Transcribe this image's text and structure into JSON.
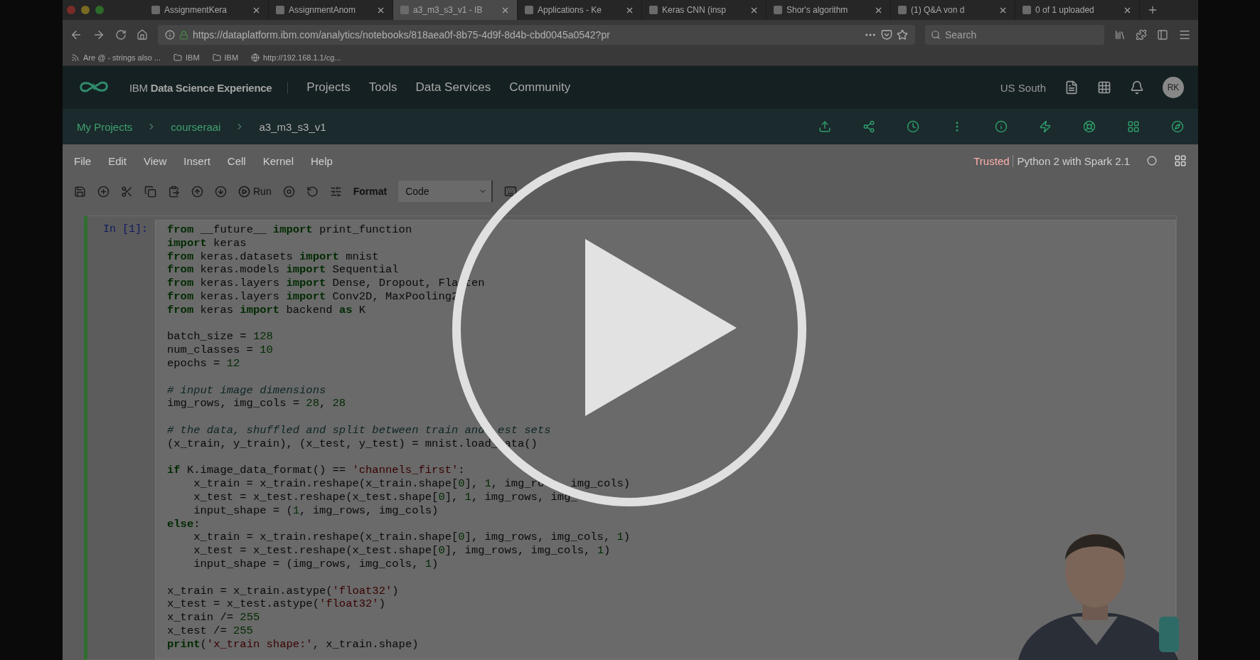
{
  "browser": {
    "tabs": [
      {
        "title": "AssignmentKera",
        "selected": false
      },
      {
        "title": "AssignmentAnom",
        "selected": false
      },
      {
        "title": "a3_m3_s3_v1 - IB",
        "selected": true
      },
      {
        "title": "Applications - Ke",
        "selected": false
      },
      {
        "title": "Keras CNN (insp",
        "selected": false
      },
      {
        "title": "Shor's algorithm",
        "selected": false
      },
      {
        "title": "(1) Q&A von d",
        "selected": false
      },
      {
        "title": "0 of 1 uploaded",
        "selected": false
      }
    ],
    "url": "https://dataplatform.ibm.com/analytics/notebooks/818aea0f-8b75-4d9f-8d4b-cbd0045a0542?pr",
    "search": {
      "placeholder": "Search"
    },
    "bookmarks": [
      {
        "kind": "feed",
        "label": "Are @ - strings also ..."
      },
      {
        "kind": "folder",
        "label": "IBM"
      },
      {
        "kind": "folder",
        "label": "IBM"
      },
      {
        "kind": "globe",
        "label": "http://192.168.1.1/cg..."
      }
    ]
  },
  "app_header": {
    "brand": "IBM **Data Science Experience**",
    "nav": [
      "Projects",
      "Tools",
      "Data Services",
      "Community"
    ],
    "region": "US South",
    "avatar": "RK"
  },
  "breadcrumbs": {
    "links": [
      "My Projects",
      "courseraai"
    ],
    "current": "a3_m3_s3_v1"
  },
  "notebook": {
    "menu": [
      "File",
      "Edit",
      "View",
      "Insert",
      "Cell",
      "Kernel",
      "Help"
    ],
    "trusted": "Trusted",
    "kernel": "Python 2 with Spark 2.1",
    "toolbar": {
      "run": "Run",
      "format_label": "Format",
      "cell_type": "Code"
    },
    "cell": {
      "prompt": "In [1]:",
      "lines": [
        {
          "kind": "code",
          "segments": [
            {
              "text": "from",
              "kind": "keyword"
            },
            {
              "text": " __future__ ",
              "kind": "plain"
            },
            {
              "text": "import",
              "kind": "keyword"
            },
            {
              "text": " print_function",
              "kind": "plain"
            }
          ]
        },
        {
          "kind": "code",
          "segments": [
            {
              "text": "import",
              "kind": "keyword"
            },
            {
              "text": " keras",
              "kind": "plain"
            }
          ]
        },
        {
          "kind": "code",
          "segments": [
            {
              "text": "from",
              "kind": "keyword"
            },
            {
              "text": " keras.datasets ",
              "kind": "plain"
            },
            {
              "text": "import",
              "kind": "keyword"
            },
            {
              "text": " mnist",
              "kind": "plain"
            }
          ]
        },
        {
          "kind": "code",
          "segments": [
            {
              "text": "from",
              "kind": "keyword"
            },
            {
              "text": " keras.models ",
              "kind": "plain"
            },
            {
              "text": "import",
              "kind": "keyword"
            },
            {
              "text": " Sequential",
              "kind": "plain"
            }
          ]
        },
        {
          "kind": "code",
          "segments": [
            {
              "text": "from",
              "kind": "keyword"
            },
            {
              "text": " keras.layers ",
              "kind": "plain"
            },
            {
              "text": "import",
              "kind": "keyword"
            },
            {
              "text": " Dense, Dropout, Fla ten",
              "kind": "plain"
            }
          ]
        },
        {
          "kind": "code",
          "segments": [
            {
              "text": "from",
              "kind": "keyword"
            },
            {
              "text": " keras.layers ",
              "kind": "plain"
            },
            {
              "text": "import",
              "kind": "keyword"
            },
            {
              "text": " Conv2D, MaxPooling2",
              "kind": "plain"
            }
          ]
        },
        {
          "kind": "code",
          "segments": [
            {
              "text": "from",
              "kind": "keyword"
            },
            {
              "text": " keras ",
              "kind": "plain"
            },
            {
              "text": "import",
              "kind": "keyword"
            },
            {
              "text": " backend ",
              "kind": "plain"
            },
            {
              "text": "as",
              "kind": "keyword"
            },
            {
              "text": " K",
              "kind": "plain"
            }
          ]
        },
        {
          "kind": "blank"
        },
        {
          "kind": "code",
          "segments": [
            {
              "text": "batch_size = ",
              "kind": "plain"
            },
            {
              "text": "128",
              "kind": "number"
            }
          ]
        },
        {
          "kind": "code",
          "segments": [
            {
              "text": "num_classes = ",
              "kind": "plain"
            },
            {
              "text": "10",
              "kind": "number"
            }
          ]
        },
        {
          "kind": "code",
          "segments": [
            {
              "text": "epochs = ",
              "kind": "plain"
            },
            {
              "text": "12",
              "kind": "number"
            }
          ]
        },
        {
          "kind": "blank"
        },
        {
          "kind": "code",
          "segments": [
            {
              "text": "# input image dimensions",
              "kind": "comment"
            }
          ]
        },
        {
          "kind": "code",
          "segments": [
            {
              "text": "img_rows, img_cols = ",
              "kind": "plain"
            },
            {
              "text": "28",
              "kind": "number"
            },
            {
              "text": ", ",
              "kind": "plain"
            },
            {
              "text": "28",
              "kind": "number"
            }
          ]
        },
        {
          "kind": "blank"
        },
        {
          "kind": "code",
          "segments": [
            {
              "text": "# the data, shuffled and split between train and  est sets",
              "kind": "comment"
            }
          ]
        },
        {
          "kind": "code",
          "segments": [
            {
              "text": "(x_train, y_train), (x_test, y_test) = mnist.load_ ata()",
              "kind": "plain"
            }
          ]
        },
        {
          "kind": "blank"
        },
        {
          "kind": "code",
          "segments": [
            {
              "text": "if",
              "kind": "keyword"
            },
            {
              "text": " K.image_data_format() == ",
              "kind": "plain"
            },
            {
              "text": "'channels_first'",
              "kind": "string"
            },
            {
              "text": ":",
              "kind": "plain"
            }
          ]
        },
        {
          "kind": "code",
          "segments": [
            {
              "text": "    x_train = x_train.reshape(x_train.shape[",
              "kind": "plain"
            },
            {
              "text": "0",
              "kind": "number"
            },
            {
              "text": "], ",
              "kind": "plain"
            },
            {
              "text": "1",
              "kind": "number"
            },
            {
              "text": ", img_ro    img_cols)",
              "kind": "plain"
            }
          ]
        },
        {
          "kind": "code",
          "segments": [
            {
              "text": "    x_test = x_test.reshape(x_test.shape[",
              "kind": "plain"
            },
            {
              "text": "0",
              "kind": "number"
            },
            {
              "text": "], ",
              "kind": "plain"
            },
            {
              "text": "1",
              "kind": "number"
            },
            {
              "text": ", img_rows, img_",
              "kind": "plain"
            }
          ]
        },
        {
          "kind": "code",
          "segments": [
            {
              "text": "    input_shape = (",
              "kind": "plain"
            },
            {
              "text": "1",
              "kind": "number"
            },
            {
              "text": ", img_rows, img_cols)",
              "kind": "plain"
            }
          ]
        },
        {
          "kind": "code",
          "segments": [
            {
              "text": "else",
              "kind": "keyword"
            },
            {
              "text": ":",
              "kind": "plain"
            }
          ]
        },
        {
          "kind": "code",
          "segments": [
            {
              "text": "    x_train = x_train.reshape(x_train.shape[",
              "kind": "plain"
            },
            {
              "text": "0",
              "kind": "number"
            },
            {
              "text": "], img_rows, img_cols, ",
              "kind": "plain"
            },
            {
              "text": "1",
              "kind": "number"
            },
            {
              "text": ")",
              "kind": "plain"
            }
          ]
        },
        {
          "kind": "code",
          "segments": [
            {
              "text": "    x_test = x_test.reshape(x_test.shape[",
              "kind": "plain"
            },
            {
              "text": "0",
              "kind": "number"
            },
            {
              "text": "], img_rows, img_cols, ",
              "kind": "plain"
            },
            {
              "text": "1",
              "kind": "number"
            },
            {
              "text": ")",
              "kind": "plain"
            }
          ]
        },
        {
          "kind": "code",
          "segments": [
            {
              "text": "    input_shape = (img_rows, img_cols, ",
              "kind": "plain"
            },
            {
              "text": "1",
              "kind": "number"
            },
            {
              "text": ")",
              "kind": "plain"
            }
          ]
        },
        {
          "kind": "blank"
        },
        {
          "kind": "code",
          "segments": [
            {
              "text": "x_train = x_train.astype(",
              "kind": "plain"
            },
            {
              "text": "'float32'",
              "kind": "string"
            },
            {
              "text": ")",
              "kind": "plain"
            }
          ]
        },
        {
          "kind": "code",
          "segments": [
            {
              "text": "x_test = x_test.astype(",
              "kind": "plain"
            },
            {
              "text": "'float32'",
              "kind": "string"
            },
            {
              "text": ")",
              "kind": "plain"
            }
          ]
        },
        {
          "kind": "code",
          "segments": [
            {
              "text": "x_train /= ",
              "kind": "plain"
            },
            {
              "text": "255",
              "kind": "number"
            }
          ]
        },
        {
          "kind": "code",
          "segments": [
            {
              "text": "x_test /= ",
              "kind": "plain"
            },
            {
              "text": "255",
              "kind": "number"
            }
          ]
        },
        {
          "kind": "code",
          "segments": [
            {
              "text": "print",
              "kind": "keyword"
            },
            {
              "text": "(",
              "kind": "plain"
            },
            {
              "text": "'x_train shape:'",
              "kind": "string"
            },
            {
              "text": ", x_train.shape)",
              "kind": "plain"
            }
          ]
        }
      ]
    }
  }
}
